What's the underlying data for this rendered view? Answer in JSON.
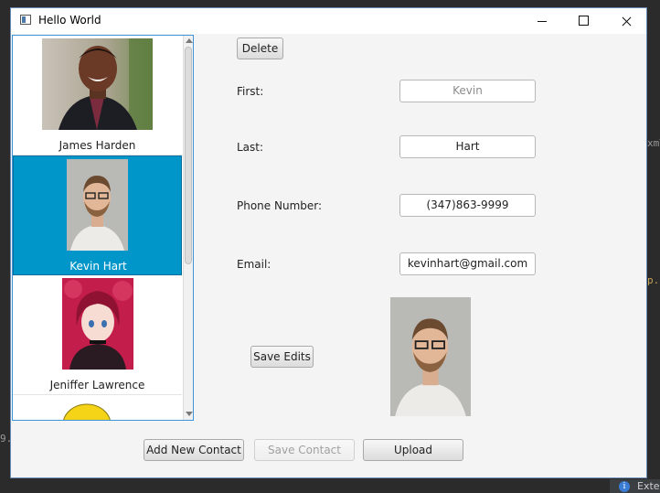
{
  "window": {
    "title": "Hello World"
  },
  "contacts": [
    {
      "name": "James Harden",
      "photo": "smiling-man-photo",
      "selected": false
    },
    {
      "name": "Kevin Hart",
      "photo": "bearded-man-photo",
      "selected": true
    },
    {
      "name": "Jeniffer Lawrence",
      "photo": "anime-girl-photo",
      "selected": false
    }
  ],
  "form": {
    "delete_label": "Delete",
    "first_label": "First:",
    "first_value": "Kevin",
    "last_label": "Last:",
    "last_value": "Hart",
    "phone_label": "Phone Number:",
    "phone_value": "(347)863-9999",
    "email_label": "Email:",
    "email_value": "kevinhart@gmail.com",
    "save_edits_label": "Save Edits"
  },
  "bottom": {
    "add_label": "Add New Contact",
    "save_contact_label": "Save Contact",
    "upload_label": "Upload"
  },
  "ide": {
    "status_text": "Exte",
    "code_right_a": "xmT",
    "code_right_b": "p.",
    "code_left": "9."
  },
  "colors": {
    "selection": "#0096c9",
    "list_border": "#3f95d6"
  }
}
